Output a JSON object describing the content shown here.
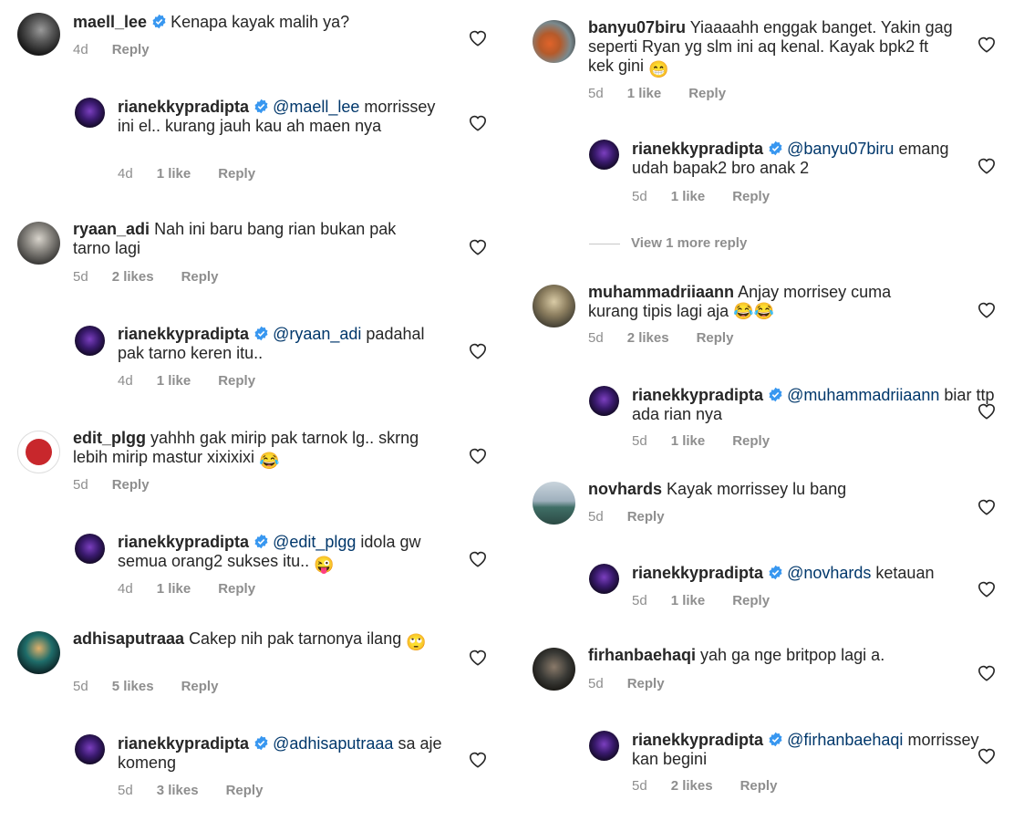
{
  "left": [
    {
      "user": "maell_lee",
      "verified": true,
      "text": "Kenapa kayak malih ya?",
      "mention": "",
      "time": "4d",
      "likes": "",
      "reply": "Reply",
      "emoji": ""
    },
    {
      "user": "rianekkypradipta",
      "verified": true,
      "mention": "@maell_lee",
      "text": "morrissey ini el.. kurang jauh kau ah maen nya",
      "time": "4d",
      "likes": "1 like",
      "reply": "Reply",
      "emoji": ""
    },
    {
      "user": "ryaan_adi",
      "verified": false,
      "text": "Nah ini baru bang rian bukan pak tarno lagi",
      "mention": "",
      "time": "5d",
      "likes": "2 likes",
      "reply": "Reply",
      "emoji": ""
    },
    {
      "user": "rianekkypradipta",
      "verified": true,
      "mention": "@ryaan_adi",
      "text": "padahal pak tarno keren itu..",
      "time": "4d",
      "likes": "1 like",
      "reply": "Reply",
      "emoji": ""
    },
    {
      "user": "edit_plgg",
      "verified": false,
      "text": "yahhh gak mirip pak tarnok lg.. skrng lebih mirip mastur xixixixi",
      "mention": "",
      "time": "5d",
      "likes": "",
      "reply": "Reply",
      "emoji": "😂"
    },
    {
      "user": "rianekkypradipta",
      "verified": true,
      "mention": "@edit_plgg",
      "text": "idola gw semua orang2 sukses itu..",
      "time": "4d",
      "likes": "1 like",
      "reply": "Reply",
      "emoji": "😜"
    },
    {
      "user": "adhisaputraaa",
      "verified": false,
      "text": "Cakep nih pak tarnonya ilang",
      "mention": "",
      "time": "5d",
      "likes": "5 likes",
      "reply": "Reply",
      "emoji": "🙄"
    },
    {
      "user": "rianekkypradipta",
      "verified": true,
      "mention": "@adhisaputraaa",
      "text": "sa aje komeng",
      "time": "5d",
      "likes": "3 likes",
      "reply": "Reply",
      "emoji": ""
    }
  ],
  "right": [
    {
      "user": "banyu07biru",
      "verified": false,
      "text": "Yiaaaahh enggak banget. Yakin gag seperti Ryan yg slm ini aq kenal. Kayak bpk2 ft kek gini",
      "mention": "",
      "time": "5d",
      "likes": "1 like",
      "reply": "Reply",
      "emoji": "😁"
    },
    {
      "user": "rianekkypradipta",
      "verified": true,
      "mention": "@banyu07biru",
      "text": "emang udah bapak2 bro anak 2",
      "time": "5d",
      "likes": "1 like",
      "reply": "Reply",
      "emoji": ""
    },
    {
      "user": "muhammadriiaann",
      "verified": false,
      "text": "Anjay morrisey cuma kurang tipis lagi aja",
      "mention": "",
      "time": "5d",
      "likes": "2 likes",
      "reply": "Reply",
      "emoji": "😂😂"
    },
    {
      "user": "rianekkypradipta",
      "verified": true,
      "mention": "@muhammadriiaann",
      "text": "biar ttp ada rian nya",
      "time": "5d",
      "likes": "1 like",
      "reply": "Reply",
      "emoji": ""
    },
    {
      "user": "novhards",
      "verified": false,
      "text": "Kayak morrissey lu bang",
      "mention": "",
      "time": "5d",
      "likes": "",
      "reply": "Reply",
      "emoji": ""
    },
    {
      "user": "rianekkypradipta",
      "verified": true,
      "mention": "@novhards",
      "text": "ketauan",
      "time": "5d",
      "likes": "1 like",
      "reply": "Reply",
      "emoji": ""
    },
    {
      "user": "firhanbaehaqi",
      "verified": false,
      "text": "yah ga nge britpop lagi a.",
      "mention": "",
      "time": "5d",
      "likes": "",
      "reply": "Reply",
      "emoji": ""
    },
    {
      "user": "rianekkypradipta",
      "verified": true,
      "mention": "@firhanbaehaqi",
      "text": "morrissey kan begini",
      "time": "5d",
      "likes": "2 likes",
      "reply": "Reply",
      "emoji": ""
    }
  ],
  "view_more": "View 1 more reply",
  "icons": {
    "heart": "heart-outline-icon",
    "verified": "verified-badge-icon"
  },
  "colors": {
    "mention": "#00376b",
    "meta": "#8e8e8e",
    "verified": "#3897f0",
    "text": "#262626"
  }
}
